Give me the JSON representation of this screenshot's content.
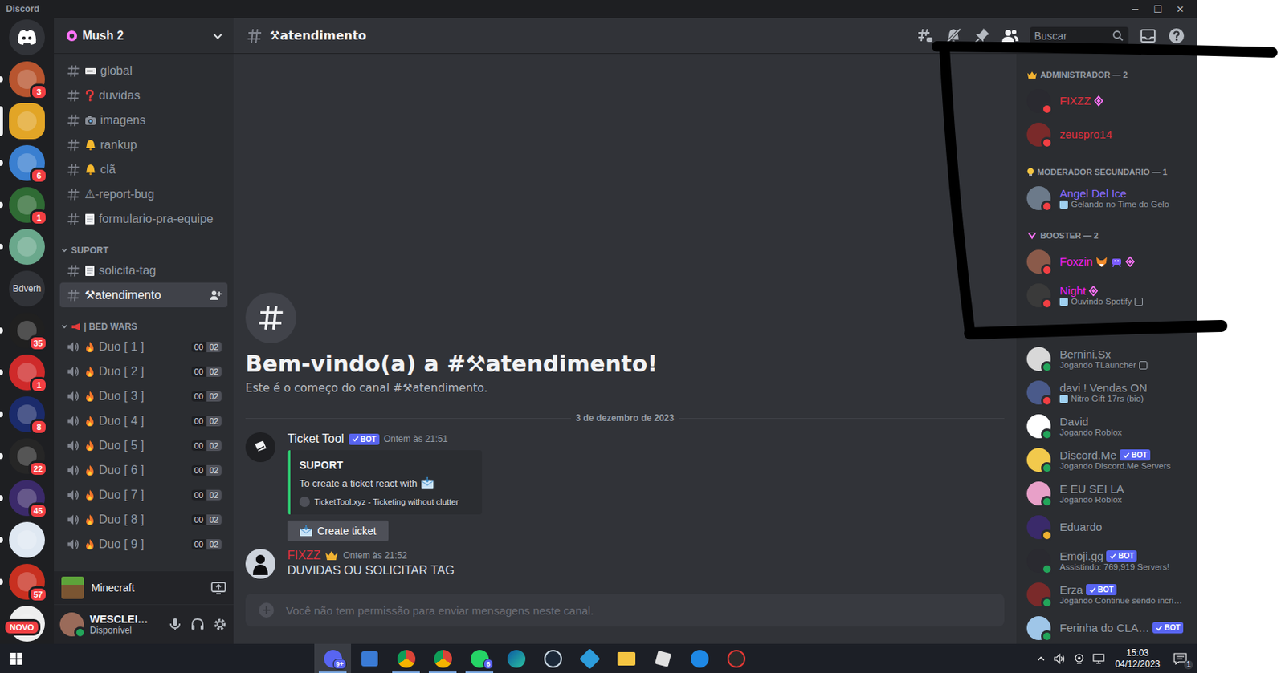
{
  "window": {
    "title": "Discord",
    "controls": [
      "─",
      "☐",
      "✕"
    ]
  },
  "servers": [
    {
      "badge": "3",
      "unread": true,
      "selected": false,
      "color": "#b8552f"
    },
    {
      "unread": false,
      "selected": true,
      "color": "#e2a526"
    },
    {
      "badge": "6",
      "unread": true,
      "selected": false,
      "color": "#3a7fd0"
    },
    {
      "badge": "1",
      "unread": true,
      "selected": false,
      "color": "#2f6b34"
    },
    {
      "unread": true,
      "selected": false,
      "color": "#6aa88c"
    },
    {
      "label": "Bdverh",
      "unread": false,
      "selected": false,
      "color": "#313338"
    },
    {
      "badge": "35",
      "unread": true,
      "selected": false,
      "color": "#202020"
    },
    {
      "badge": "1",
      "unread": true,
      "selected": false,
      "color": "#cf2a2a"
    },
    {
      "badge": "8",
      "unread": true,
      "selected": false,
      "color": "#1b2b6b"
    },
    {
      "badge": "22",
      "unread": true,
      "selected": false,
      "color": "#262626"
    },
    {
      "badge": "45",
      "unread": true,
      "selected": false,
      "color": "#3b2a6a"
    },
    {
      "unread": true,
      "selected": false,
      "color": "#dfe8f2"
    },
    {
      "badge": "57",
      "unread": true,
      "selected": false,
      "color": "#c83020"
    },
    {
      "badge": "NOVO",
      "unread": false,
      "selected": false,
      "color": "#eeeeee"
    }
  ],
  "guild": {
    "name": "Mush 2"
  },
  "channels": [
    {
      "kind": "text",
      "name": "global",
      "icon": "card",
      "selected": false
    },
    {
      "kind": "text",
      "name": "duvidas",
      "icon": "question",
      "selected": false
    },
    {
      "kind": "text",
      "name": "imagens",
      "icon": "camera",
      "selected": false
    },
    {
      "kind": "text",
      "name": "rankup",
      "icon": "bell",
      "selected": false
    },
    {
      "kind": "text",
      "name": "clã",
      "icon": "bell",
      "selected": false
    },
    {
      "kind": "text",
      "name": "⚠-report-bug",
      "selected": false
    },
    {
      "kind": "text",
      "name": "formulario-pra-equipe",
      "icon": "page",
      "selected": false
    },
    {
      "kind": "category",
      "name": "SUPORT",
      "expanded": true
    },
    {
      "kind": "text",
      "name": "solicita-tag",
      "icon": "page",
      "selected": false
    },
    {
      "kind": "text",
      "name": "⚒atendimento",
      "selected": true
    },
    {
      "kind": "category",
      "name": "| BED WARS",
      "icon": "megaphone",
      "expanded": true
    },
    {
      "kind": "voice",
      "name": "Duo [ 1 ]",
      "icon": "fire",
      "users": "00",
      "limit": "02",
      "selected": false
    },
    {
      "kind": "voice",
      "name": "Duo [ 2 ]",
      "icon": "fire",
      "users": "00",
      "limit": "02",
      "selected": false
    },
    {
      "kind": "voice",
      "name": "Duo [ 3 ]",
      "icon": "fire",
      "users": "00",
      "limit": "02",
      "selected": false
    },
    {
      "kind": "voice",
      "name": "Duo [ 4 ]",
      "icon": "fire",
      "users": "00",
      "limit": "02",
      "selected": false
    },
    {
      "kind": "voice",
      "name": "Duo [ 5 ]",
      "icon": "fire",
      "users": "00",
      "limit": "02",
      "selected": false
    },
    {
      "kind": "voice",
      "name": "Duo [ 6 ]",
      "icon": "fire",
      "users": "00",
      "limit": "02",
      "selected": false
    },
    {
      "kind": "voice",
      "name": "Duo [ 7 ]",
      "icon": "fire",
      "users": "00",
      "limit": "02",
      "selected": false
    },
    {
      "kind": "voice",
      "name": "Duo [ 8 ]",
      "icon": "fire",
      "users": "00",
      "limit": "02",
      "selected": false
    },
    {
      "kind": "voice",
      "name": "Duo [ 9 ]",
      "icon": "fire",
      "users": "00",
      "limit": "02",
      "selected": false
    }
  ],
  "activity": {
    "game": "Minecraft"
  },
  "user": {
    "name": "WESCLEI…",
    "status_text": "Disponível",
    "status": "online"
  },
  "header": {
    "channel": "⚒atendimento",
    "search": "Buscar"
  },
  "welcome": {
    "title": "Bem-vindo(a) a #⚒atendimento!",
    "subtitle": "Este é o começo do canal #⚒atendimento."
  },
  "date_divider": "3 de dezembro de 2023",
  "messages": [
    {
      "author": "Ticket Tool",
      "tag": "BOT",
      "time": "Ontem às 21:51",
      "embed": {
        "title": "SUPORT",
        "text": "To create a ticket react with",
        "footer": "TicketTool.xyz - Ticketing without clutter",
        "color": "#2ecc71"
      },
      "button": "Create ticket"
    },
    {
      "author": "FIXZZ",
      "color": "#e3313e",
      "crown": true,
      "time": "Ontem às 21:52",
      "text": "DUVIDAS OU SOLICITAR TAG"
    }
  ],
  "input": {
    "placeholder": "Você não tem permissão para enviar mensagens neste canal."
  },
  "member_groups": [
    {
      "title": "ADMINISTRADOR — 2",
      "icon": "crown",
      "members": [
        {
          "name": "FIXZZ",
          "color": "#e3313e",
          "status": "dnd",
          "nitro": true
        },
        {
          "name": "zeuspro14",
          "color": "#e3313e",
          "status": "dnd"
        }
      ]
    },
    {
      "title": "MODERADOR SECUNDARIO — 1",
      "icon": "bulb",
      "members": [
        {
          "name": "Angel Del Ice",
          "color": "#8c6cff",
          "status": "dnd",
          "activity": "Gelando no Time do Gelo",
          "activity_icon": true
        }
      ]
    },
    {
      "title": "BOOSTER — 2",
      "icon": "boost",
      "members": [
        {
          "name": "Foxzin",
          "color": "#f01ef0",
          "status": "dnd",
          "emojis": [
            "fox",
            "invader"
          ],
          "nitro": true
        },
        {
          "name": "Night",
          "color": "#f01ef0",
          "status": "dnd",
          "nitro": true,
          "activity": "Ouvindo Spotify",
          "activity_icon": true,
          "rich": true
        }
      ]
    }
  ],
  "online_members": [
    {
      "name": "Bernini.Sx",
      "status": "online",
      "activity": "Jogando TLauncher",
      "rich": true
    },
    {
      "name": "davi ! Vendas ON",
      "status": "dnd",
      "activity": "Nitro Gift 17rs (bio)",
      "activity_icon": true
    },
    {
      "name": "David",
      "status": "online",
      "activity": "Jogando Roblox"
    },
    {
      "name": "Discord.Me",
      "status": "online",
      "bot": "BOT",
      "activity": "Jogando Discord.Me Servers"
    },
    {
      "name": "E EU SEI LA",
      "status": "online",
      "activity": "Jogando Roblox"
    },
    {
      "name": "Eduardo",
      "status": "idle"
    },
    {
      "name": "Emoji.gg",
      "status": "online",
      "bot": "BOT",
      "activity": "Assistindo: 769,919 Servers!"
    },
    {
      "name": "Erza",
      "status": "online",
      "bot": "BOT",
      "activity": "Jogando Continue sendo incri…"
    },
    {
      "name": "Ferinha do CLA…",
      "status": "online",
      "bot": "BOT"
    }
  ],
  "taskbar": {
    "apps": [
      {
        "kind": "discord",
        "badge": "9+",
        "active": true,
        "open": true
      },
      {
        "kind": "store",
        "active": false,
        "open": false
      },
      {
        "kind": "chrome",
        "active": false,
        "open": true
      },
      {
        "kind": "chrome",
        "active": false,
        "open": true
      },
      {
        "kind": "whatsapp",
        "badge": "6",
        "active": false,
        "open": true
      },
      {
        "kind": "edge",
        "active": false,
        "open": false
      },
      {
        "kind": "steam",
        "active": false,
        "open": false
      },
      {
        "kind": "box",
        "active": false,
        "open": false
      },
      {
        "kind": "folder",
        "active": false,
        "open": false
      },
      {
        "kind": "roblox",
        "active": false,
        "open": false
      },
      {
        "kind": "blue",
        "active": false,
        "open": false
      },
      {
        "kind": "red",
        "active": false,
        "open": false
      }
    ],
    "time": "15:03",
    "date": "04/12/2023",
    "notifications": "1"
  }
}
